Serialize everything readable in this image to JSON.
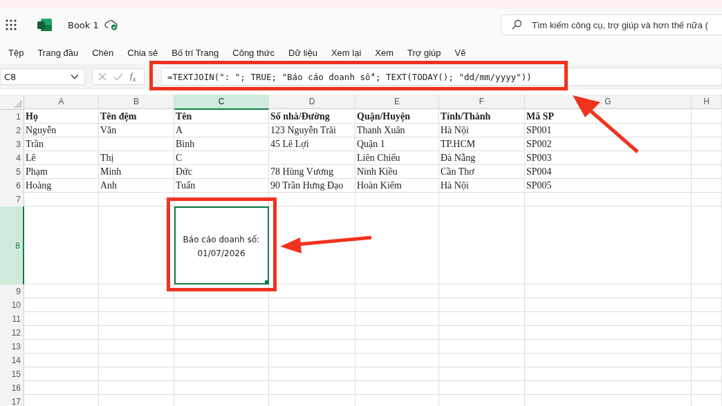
{
  "header": {
    "title": "Book 1",
    "search": {
      "placeholder": "Tìm kiếm công cụ, trợ giúp và hơn thế nữa ("
    }
  },
  "menu": [
    "Tệp",
    "Trang đầu",
    "Chèn",
    "Chia sẻ",
    "Bố trí Trang",
    "Công thức",
    "Dữ liệu",
    "Xem lại",
    "Xem",
    "Trợ giúp",
    "Vẽ"
  ],
  "formula_bar": {
    "name_box": "C8",
    "function_label": "f$_{x}$",
    "formula": "=TEXTJOIN(\": \"; TRUE; \"Báo cáo doanh số\"; TEXT(TODAY(); \"dd/mm/yyyy\"))"
  },
  "columns": [
    {
      "label": "A",
      "selected": false
    },
    {
      "label": "B",
      "selected": false
    },
    {
      "label": "C",
      "selected": true
    },
    {
      "label": "D",
      "selected": false
    },
    {
      "label": "E",
      "selected": false
    },
    {
      "label": "F",
      "selected": false
    },
    {
      "label": "G",
      "selected": false
    },
    {
      "label": "H",
      "selected": false
    }
  ],
  "rows": [
    {
      "label": "1",
      "kind": "header",
      "selected": false,
      "cells": {
        "A": "Họ",
        "B": "Tên đệm",
        "C": "Tên",
        "D": "Số nhà/Đường",
        "E": "Quận/Huyện",
        "F": "Tỉnh/Thành",
        "G": "Mã SP"
      }
    },
    {
      "label": "2",
      "kind": "data",
      "selected": false,
      "cells": {
        "A": "Nguyễn",
        "B": "Văn",
        "C": "A",
        "D": "123 Nguyễn Trãi",
        "E": "Thanh Xuân",
        "F": "Hà Nội",
        "G": "SP001"
      }
    },
    {
      "label": "3",
      "kind": "data",
      "selected": false,
      "cells": {
        "A": "Trần",
        "C": "Bình",
        "D": "45 Lê Lợi",
        "E": "Quận 1",
        "F": "TP.HCM",
        "G": "SP002"
      }
    },
    {
      "label": "4",
      "kind": "data",
      "selected": false,
      "cells": {
        "A": "Lê",
        "B": "Thị",
        "C": "C",
        "E": "Liên Chiểu",
        "F": "Đà Nẵng",
        "G": "SP003"
      }
    },
    {
      "label": "5",
      "kind": "data",
      "selected": false,
      "cells": {
        "A": "Phạm",
        "B": "Minh",
        "C": "Đức",
        "D": "78 Hùng Vương",
        "E": "Ninh Kiều",
        "F": "Cần Thơ",
        "G": "SP004"
      }
    },
    {
      "label": "6",
      "kind": "data",
      "selected": false,
      "cells": {
        "A": "Hoàng",
        "B": "Anh",
        "C": "Tuấn",
        "D": "90 Trần Hưng Đạo",
        "E": "Hoàn Kiếm",
        "F": "Hà Nội",
        "G": "SP005"
      }
    },
    {
      "label": "7",
      "kind": "data",
      "selected": false
    },
    {
      "label": "8",
      "kind": "tall",
      "selected": true,
      "cells": {
        "C": "Báo cáo doanh số: 01/07/2026"
      }
    },
    {
      "label": "9",
      "kind": "data",
      "selected": false
    },
    {
      "label": "10",
      "kind": "data",
      "selected": false
    },
    {
      "label": "11",
      "kind": "data",
      "selected": false
    },
    {
      "label": "12",
      "kind": "data",
      "selected": false
    },
    {
      "label": "13",
      "kind": "data",
      "selected": false
    },
    {
      "label": "14",
      "kind": "data",
      "selected": false
    },
    {
      "label": "15",
      "kind": "data",
      "selected": false
    },
    {
      "label": "16",
      "kind": "data",
      "selected": false
    },
    {
      "label": "17",
      "kind": "data",
      "selected": false
    }
  ]
}
